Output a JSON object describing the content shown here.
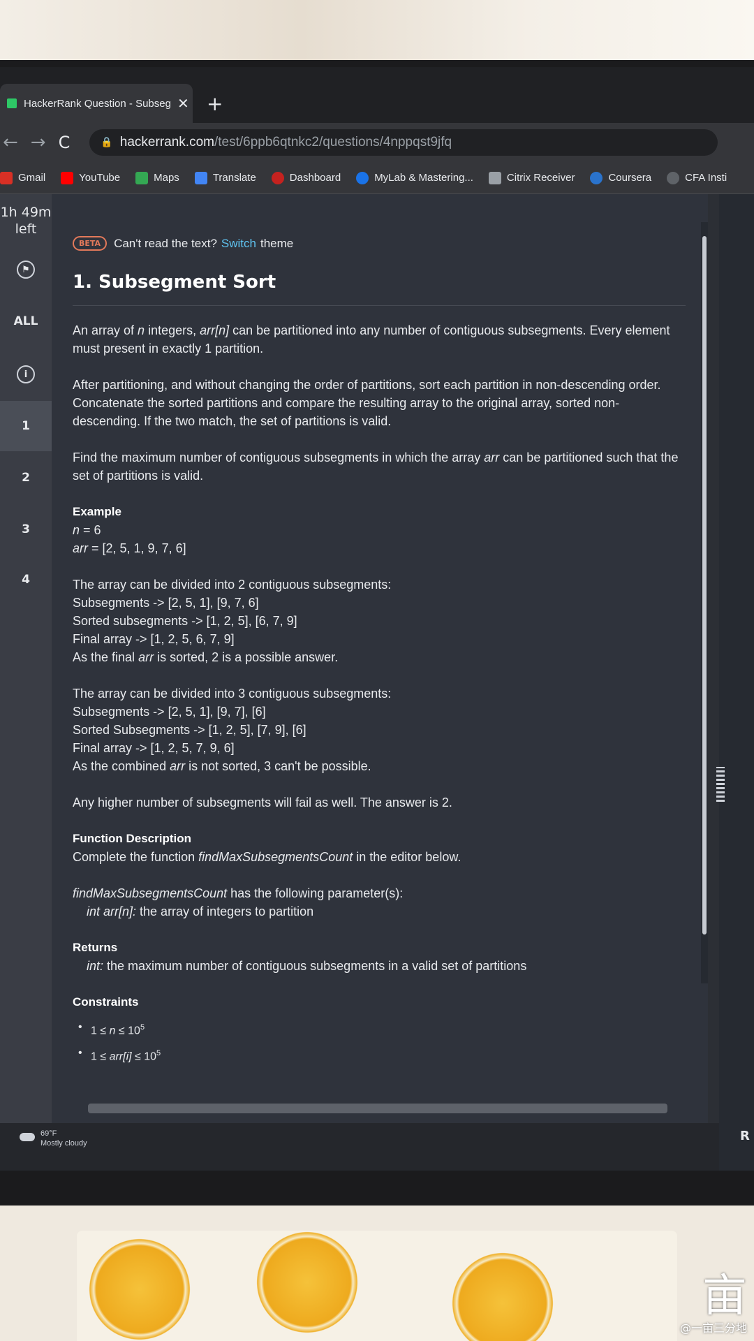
{
  "browser": {
    "tab_title": "HackerRank Question - Subsegm",
    "tab_close": "✕",
    "new_tab": "+",
    "back": "←",
    "forward": "→",
    "reload": "C",
    "url_host": "hackerrank.com",
    "url_path": "/test/6ppb6qtnkc2/questions/4nppqst9jfq"
  },
  "bookmarks": [
    {
      "label": "Gmail",
      "color": "#d93025"
    },
    {
      "label": "YouTube",
      "color": "#ff0000"
    },
    {
      "label": "Maps",
      "color": "#34a853"
    },
    {
      "label": "Translate",
      "color": "#4285f4"
    },
    {
      "label": "Dashboard",
      "color": "#c5221f"
    },
    {
      "label": "MyLab & Mastering...",
      "color": "#1a73e8"
    },
    {
      "label": "Citrix Receiver",
      "color": "#9aa0a6"
    },
    {
      "label": "Coursera",
      "color": "#2a73cc"
    },
    {
      "label": "CFA Insti",
      "color": "#5f6368"
    }
  ],
  "sidebar": {
    "timer_line1": "1h 49m",
    "timer_line2": "left",
    "all_label": "ALL",
    "questions": [
      "1",
      "2",
      "3",
      "4"
    ],
    "active_question": "1"
  },
  "banner": {
    "badge": "BETA",
    "text_before": "Can't read the text?",
    "link": "Switch",
    "text_after": "theme"
  },
  "problem": {
    "title": "1. Subsegment Sort",
    "p1_a": "An array of ",
    "p1_n": "n",
    "p1_b": " integers, ",
    "p1_arr": "arr[n]",
    "p1_c": " can be partitioned into any number of contiguous subsegments. Every element must present in exactly 1 partition.",
    "p2": "After partitioning, and without changing the order of partitions, sort each partition in non-descending order. Concatenate the sorted partitions and compare the resulting array to the original array, sorted non-descending. If the two match, the set of partitions is valid.",
    "p3_a": "Find the maximum number of contiguous subsegments in which the array ",
    "p3_arr": "arr",
    "p3_b": " can be partitioned such that the set of partitions is valid.",
    "example_heading": "Example",
    "example_n_var": "n",
    "example_n_val": " = 6",
    "example_arr_var": "arr",
    "example_arr_val": " = [2, 5, 1, 9, 7, 6]",
    "ex1": [
      "The array can be divided into 2 contiguous subsegments:",
      "Subsegments -> [2, 5, 1], [9, 7, 6]",
      "Sorted subsegments -> [1, 2, 5], [6, 7, 9]",
      "Final array -> [1, 2, 5, 6, 7, 9]"
    ],
    "ex1_last_a": "As the final ",
    "ex1_last_var": "arr",
    "ex1_last_b": " is sorted, 2 is a possible answer.",
    "ex2": [
      "The array can be divided into 3 contiguous subsegments:",
      "Subsegments -> [2, 5, 1], [9, 7], [6]",
      "Sorted Subsegments -> [1, 2, 5], [7, 9], [6]",
      "Final array -> [1, 2, 5, 7, 9, 6]"
    ],
    "ex2_last_a": "As the combined ",
    "ex2_last_var": "arr",
    "ex2_last_b": " is not sorted, 3 can't be possible.",
    "p_higher": "Any higher number of subsegments will fail as well. The answer is 2.",
    "func_heading": "Function Description",
    "func_a": "Complete the function ",
    "func_name": "findMaxSubsegmentsCount",
    "func_b": " in the editor below.",
    "params_name": "findMaxSubsegmentsCount",
    "params_b": " has the following parameter(s):",
    "param_type": "int arr[n]:",
    "param_desc": "  the array of integers to partition",
    "returns_heading": "Returns",
    "returns_type": "int:",
    "returns_desc": " the maximum number of contiguous subsegments in a valid set of partitions",
    "constraints_heading": "Constraints",
    "c1_a": "1 ≤ ",
    "c1_var": "n",
    "c1_b": " ≤ 10",
    "c1_sup": "5",
    "c2_a": "1 ≤ ",
    "c2_var": "arr[i]",
    "c2_b": " ≤ 10",
    "c2_sup": "5"
  },
  "right_panel": {
    "run_partial": "R"
  },
  "taskbar": {
    "temp": "69°F",
    "weather": "Mostly cloudy"
  },
  "watermark": {
    "glyph": "亩",
    "text": "@一亩三分地"
  }
}
